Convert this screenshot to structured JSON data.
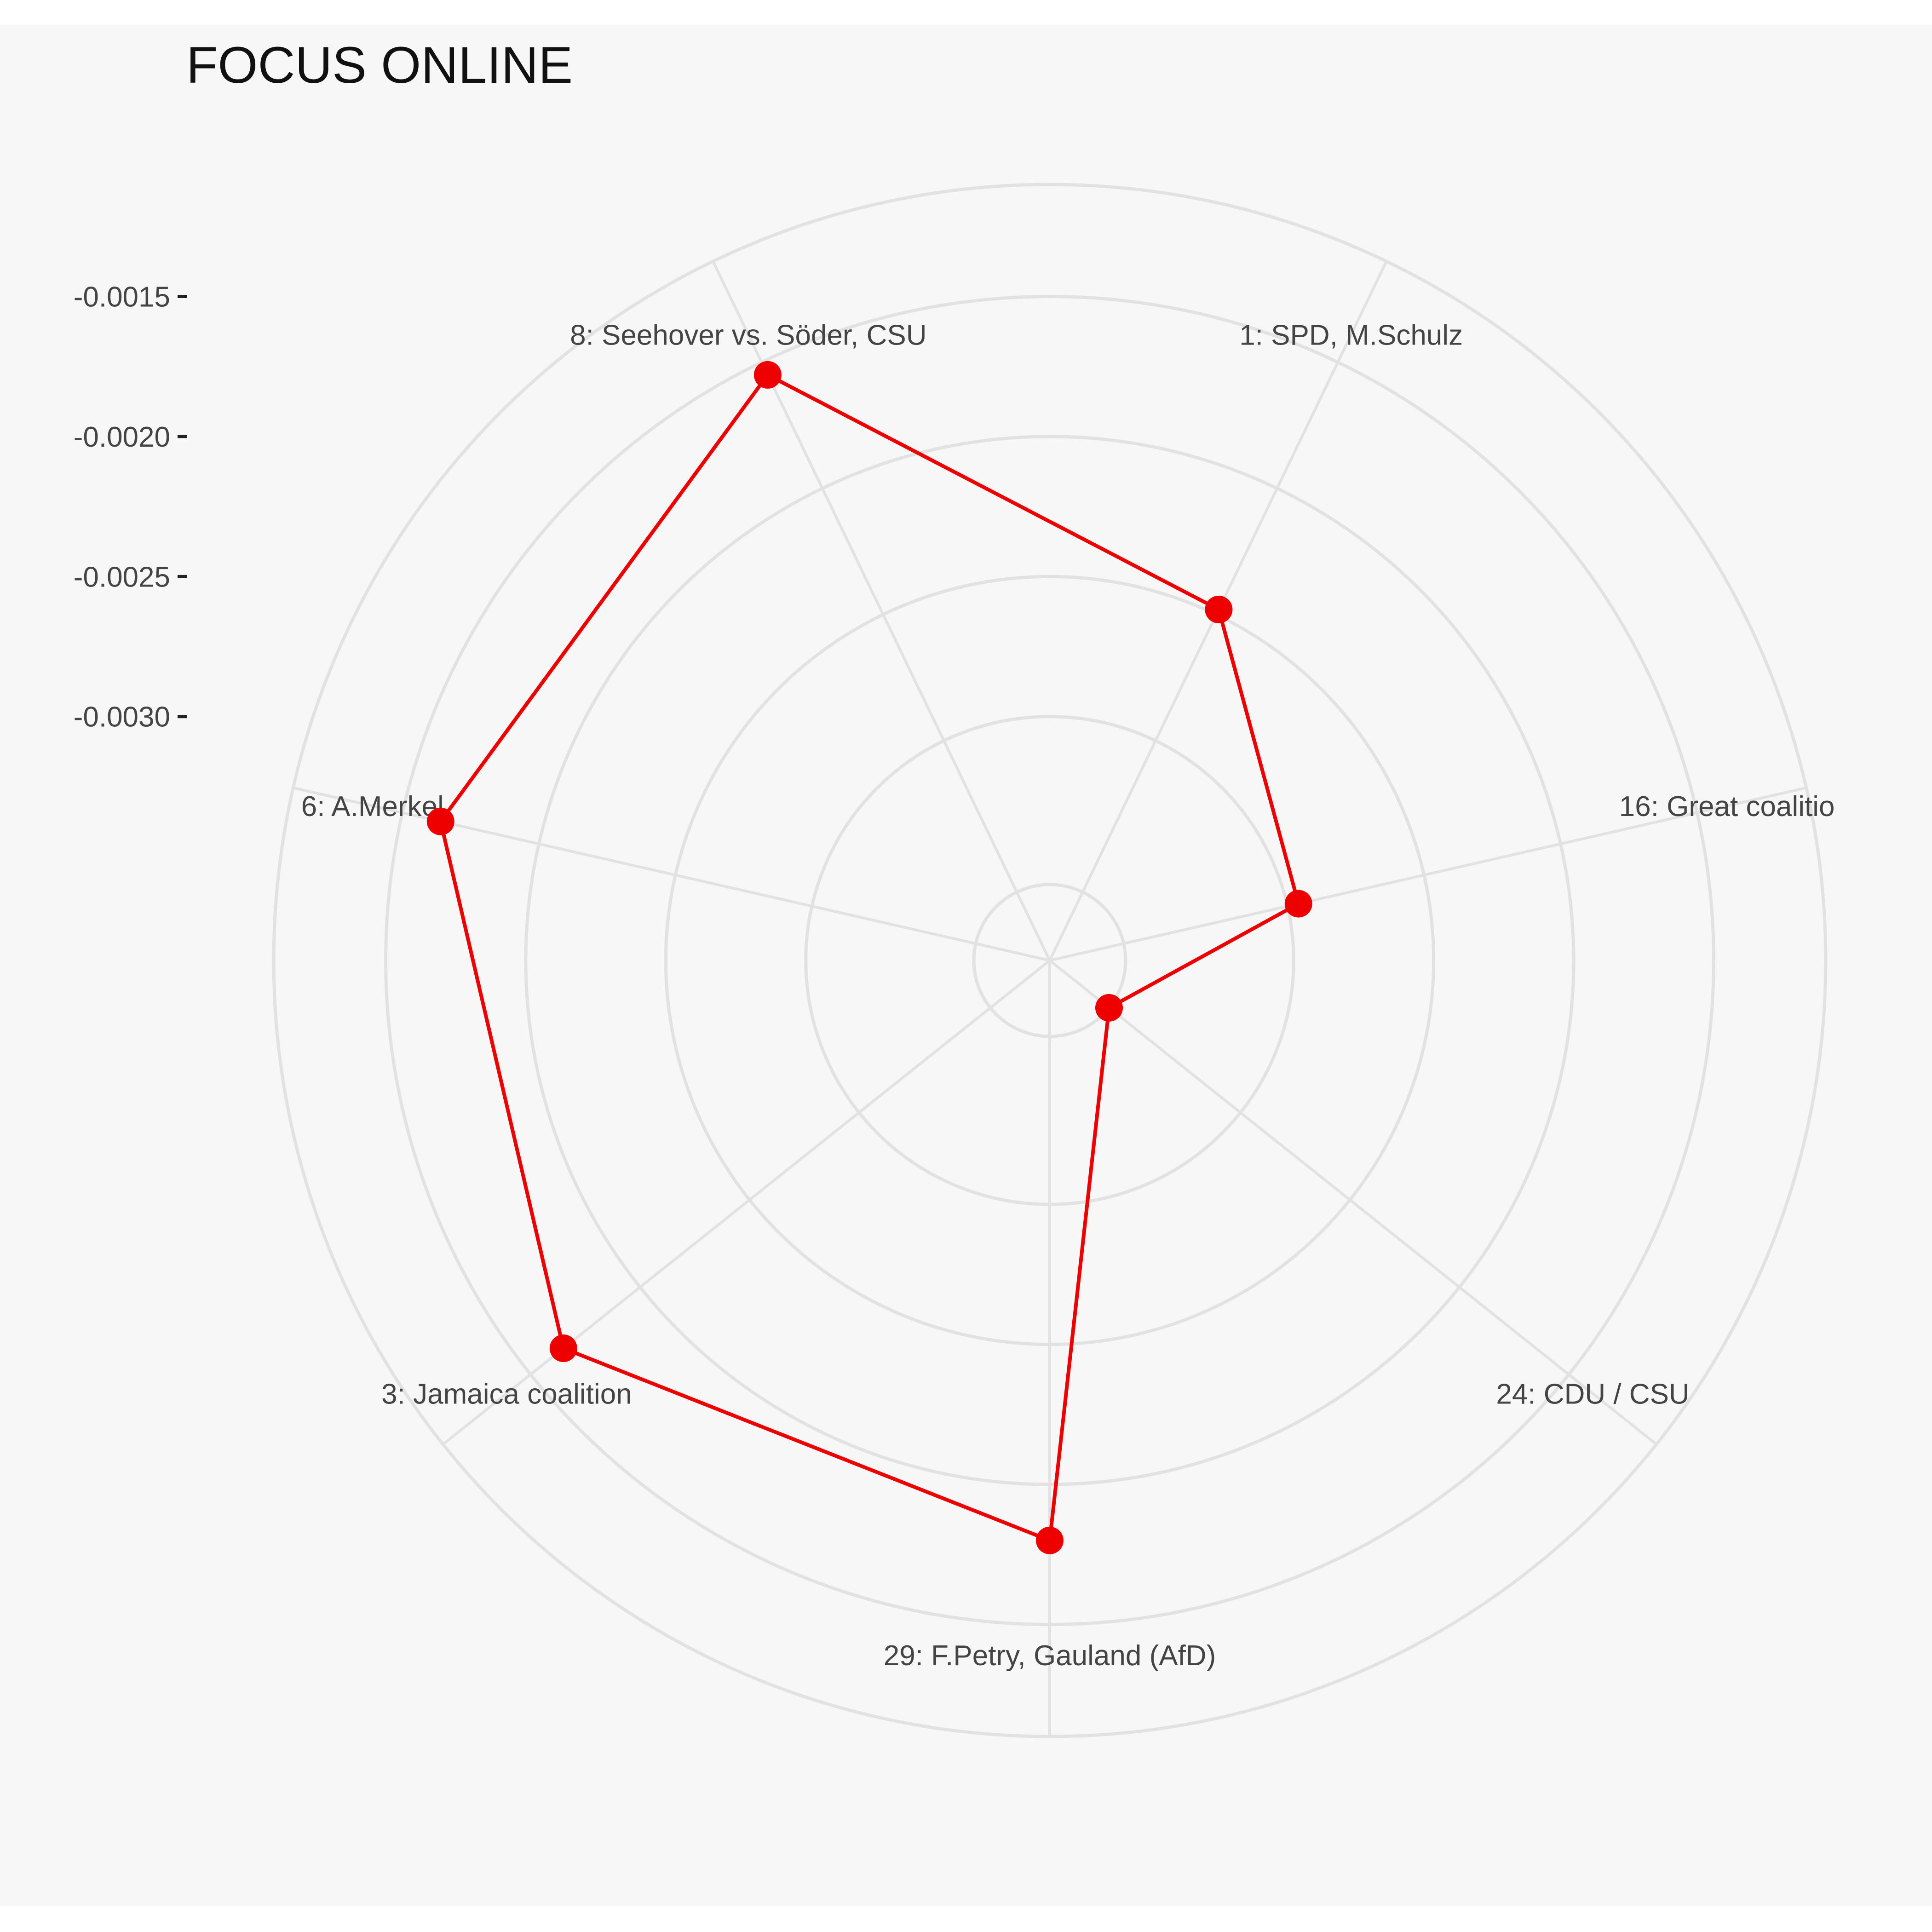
{
  "chart_data": {
    "type": "radar",
    "title": "FOCUS ONLINE",
    "categories": [
      "1: SPD, M.Schulz",
      "16: Great coalitio",
      "24: CDU / CSU",
      "29: F.Petry, Gauland (AfD)",
      "3: Jamaica coalition",
      "6: A.Merkel",
      "8: Seehover vs. Söder, CSU"
    ],
    "series": [
      {
        "values": [
          -0.00248,
          -0.00296,
          -0.0036,
          -0.0018,
          -0.00165,
          -0.00164,
          -0.00155
        ],
        "color": "#ee0000"
      }
    ],
    "radial_axis": {
      "min": -0.0036,
      "max": -0.0011,
      "ticks": [
        -0.0015,
        -0.002,
        -0.0025,
        -0.003
      ],
      "tick_labels": [
        "-0.0015",
        "-0.0020",
        "-0.0025",
        "-0.0030"
      ]
    },
    "grid": true,
    "legend": "none",
    "colors": {
      "series": "#ee0000",
      "grid": "#e2e2e2",
      "background": "#f7f7f7"
    }
  }
}
